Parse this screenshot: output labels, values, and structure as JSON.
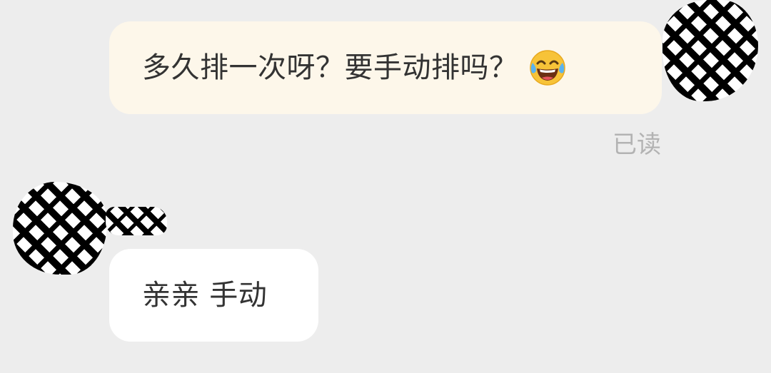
{
  "messages": [
    {
      "direction": "outgoing",
      "text": "多久排一次呀？要手动排吗？",
      "emoji": "face-with-tears-of-joy-icon",
      "status": "已读"
    },
    {
      "direction": "incoming",
      "text": "亲亲 手动"
    }
  ],
  "colors": {
    "background": "#ededed",
    "outgoing_bubble": "#fdf7ea",
    "incoming_bubble": "#ffffff",
    "text": "#333333",
    "read_receipt": "#b3b3b3"
  }
}
